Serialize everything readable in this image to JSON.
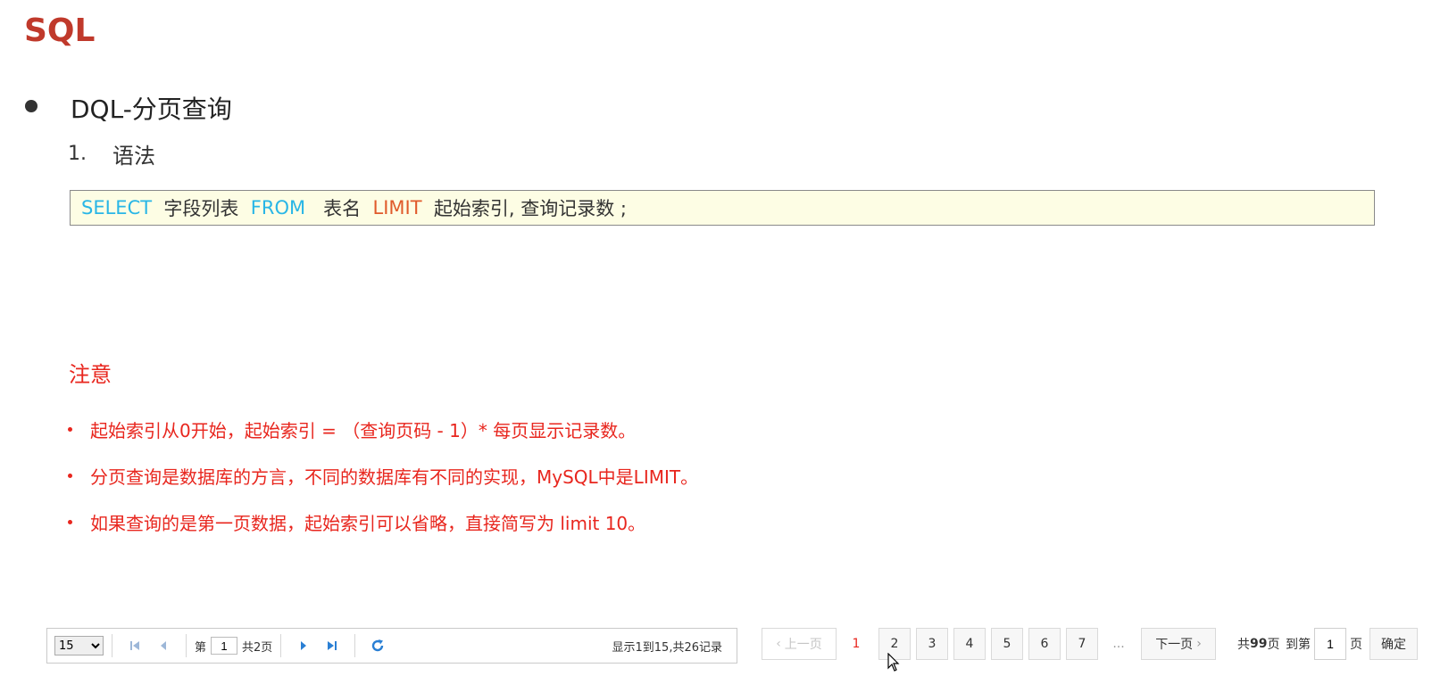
{
  "slide": {
    "title": "SQL",
    "heading": "DQL-分页查询",
    "step_number": "1.",
    "step_label": "语法",
    "syntax": {
      "kw1": "SELECT",
      "t1": "字段列表",
      "kw2": "FROM",
      "t2": "表名",
      "kw3": "LIMIT",
      "t3": "起始索引, 查询记录数 ;"
    },
    "note_title": "注意",
    "notes": [
      "起始索引从0开始，起始索引 = （查询页码 - 1）* 每页显示记录数。",
      "分页查询是数据库的方言，不同的数据库有不同的实现，MySQL中是LIMIT。",
      "如果查询的是第一页数据，起始索引可以省略，直接简写为 limit 10。"
    ]
  },
  "pager_left": {
    "page_size": "15",
    "page_size_options": [
      "15"
    ],
    "page_prefix": "第",
    "page_value": "1",
    "page_total": "共2页",
    "info": "显示1到15,共26记录",
    "icons": {
      "first": "first-page-icon",
      "prev": "prev-page-icon",
      "next": "next-page-icon",
      "last": "last-page-icon",
      "refresh": "refresh-icon"
    },
    "colors": {
      "icon_blue": "#2a7fd4"
    }
  },
  "pager_right": {
    "prev_label": "上一页",
    "current_page": "1",
    "pages": [
      "2",
      "3",
      "4",
      "5",
      "6",
      "7"
    ],
    "ellipsis": "...",
    "next_label": "下一页",
    "total_prefix": "共",
    "total_value": "99",
    "total_suffix": "页",
    "goto_prefix": "到第",
    "goto_value": "1",
    "goto_suffix": "页",
    "confirm_label": "确定"
  },
  "colors": {
    "title": "#c0392b",
    "note": "#e8261e",
    "keyword_blue": "#29b6e6",
    "keyword_red": "#e05a2b",
    "code_bg": "#fdfde4"
  }
}
